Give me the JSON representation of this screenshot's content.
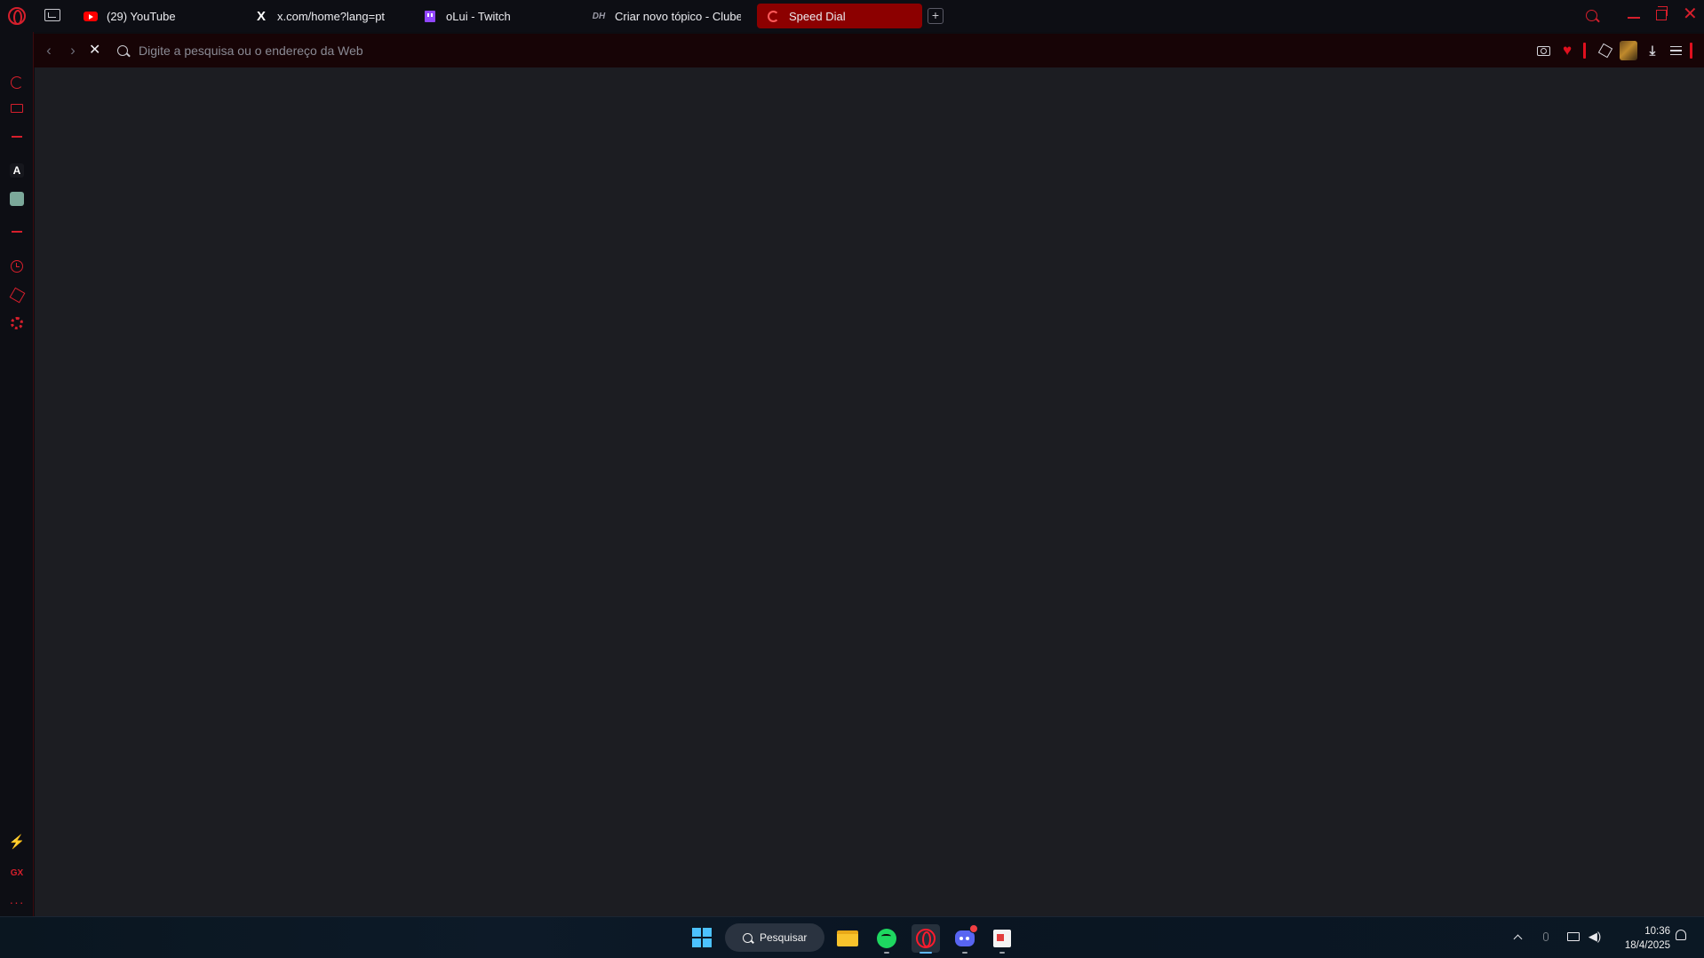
{
  "tabs": [
    {
      "title": "(29) YouTube",
      "favicon": "youtube-icon",
      "active": false
    },
    {
      "title": "x.com/home?lang=pt",
      "favicon": "x-icon",
      "active": false
    },
    {
      "title": "oLui - Twitch",
      "favicon": "twitch-icon",
      "active": false
    },
    {
      "title": "Criar novo tópico - Clube",
      "favicon": "clube-icon",
      "active": false
    },
    {
      "title": "Speed Dial",
      "favicon": "loading-spinner-icon",
      "active": true
    }
  ],
  "new_tab_label": "+",
  "close_glyph": "✕",
  "address_bar": {
    "placeholder": "Digite a pesquisa ou o endereço da Web",
    "value": ""
  },
  "nav": {
    "back_glyph": "‹",
    "forward_glyph": "›",
    "stop_glyph": "✕"
  },
  "sidebar": {
    "items": [
      "speed-dial-icon",
      "shop-icon",
      "separator",
      "app-a-icon",
      "chatgpt-icon",
      "separator",
      "history-icon",
      "extensions-icon",
      "settings-icon"
    ],
    "bottom": {
      "gx_label": "GX",
      "more_glyph": "···"
    }
  },
  "toolbar": {
    "heart_glyph": "♥",
    "download_glyph": "⤓"
  },
  "taskbar": {
    "search_label": "Pesquisar",
    "apps": [
      "file-explorer-icon",
      "spotify-icon",
      "opera-gx-icon",
      "discord-icon",
      "paint-icon"
    ],
    "time": "10:36",
    "date": "18/4/2025"
  },
  "colors": {
    "accent": "#d61f2c",
    "active_tab": "#8c0000",
    "content_bg": "#1c1d22",
    "address_bar_bg": "#170406"
  }
}
